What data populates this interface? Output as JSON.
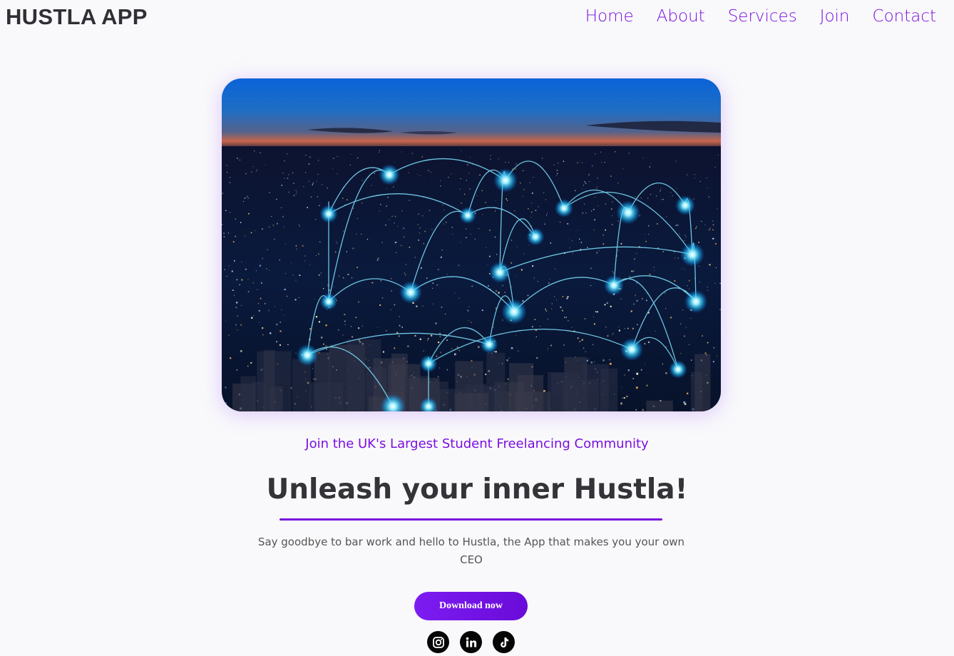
{
  "brand": {
    "name": "HUSTLA APP"
  },
  "nav": {
    "items": [
      {
        "label": "Home"
      },
      {
        "label": "About"
      },
      {
        "label": "Services"
      },
      {
        "label": "Join"
      },
      {
        "label": "Contact"
      }
    ]
  },
  "hero": {
    "tagline": "Join the UK's Largest Student Freelancing Community",
    "headline": "Unleash your inner Hustla!",
    "description": "Say goodbye to bar work and hello to Hustla, the App that makes you your own CEO",
    "cta_label": "Download now"
  },
  "socials": [
    {
      "icon": "instagram-icon"
    },
    {
      "icon": "linkedin-icon"
    },
    {
      "icon": "tiktok-icon"
    }
  ],
  "colors": {
    "accent": "#7a0fe0",
    "background": "#f9f9fb",
    "heading": "#333338"
  }
}
